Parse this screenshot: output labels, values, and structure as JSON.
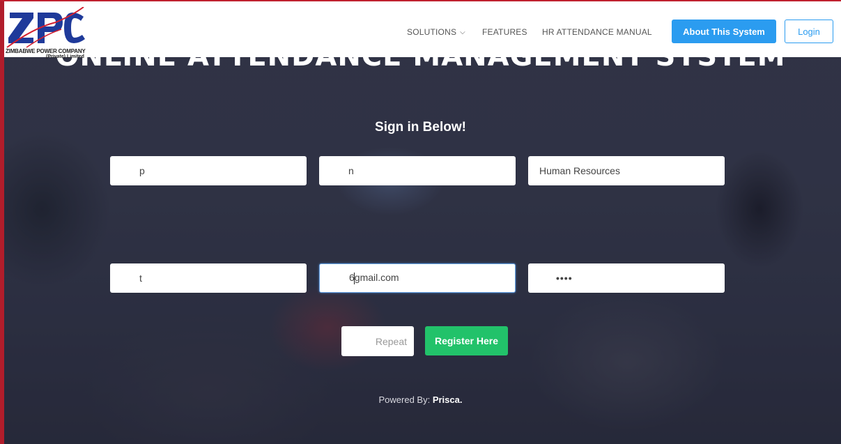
{
  "brand": {
    "logo_text": "ZPC",
    "company_line1": "ZIMBABWE POWER COMPANY",
    "company_line2": "(Private) Limited"
  },
  "nav": {
    "items": [
      {
        "label": "SOLUTIONS",
        "icon": "chevron-down-icon"
      },
      {
        "label": "FEATURES"
      },
      {
        "label": "HR ATTENDANCE MANUAL"
      }
    ],
    "about_button": "About This System",
    "login_button": "Login"
  },
  "hero": {
    "title": "ONLINE ATTENDANCE MANAGEMENT SYSTEM",
    "subtitle": "Sign in Below!"
  },
  "form": {
    "row1": [
      {
        "value": "p"
      },
      {
        "value": "n"
      },
      {
        "value": "Human Resources"
      }
    ],
    "row2": [
      {
        "value": "t"
      },
      {
        "value_before": "6",
        "value_after": "gmail.com"
      },
      {
        "value": "••••"
      }
    ],
    "repeat_placeholder": "Repeat",
    "register_button": "Register Here"
  },
  "footer": {
    "powered_label": "Powered By:",
    "powered_name": "Prisca."
  },
  "colors": {
    "primary": "#2b9cf0",
    "success": "#22c26a",
    "brand_red": "#c0212f",
    "logo_blue": "#1f3a9a"
  }
}
